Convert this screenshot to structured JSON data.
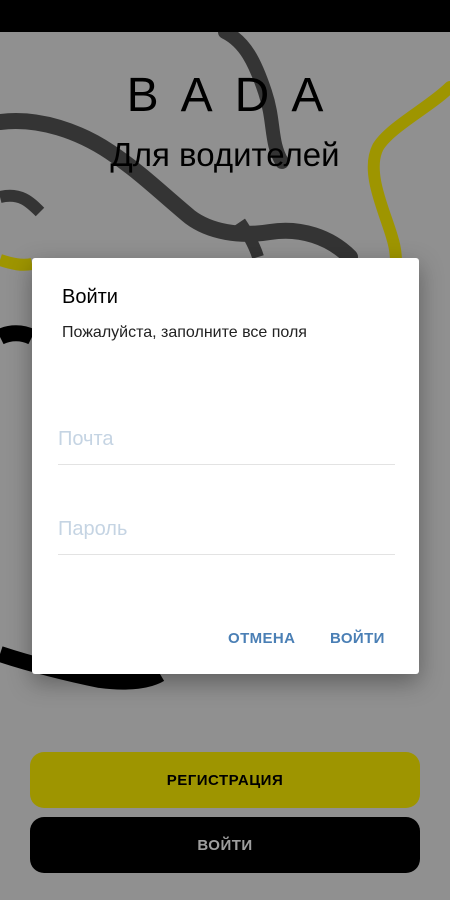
{
  "brand": {
    "title": "BADA",
    "subtitle": "Для водителей"
  },
  "buttons": {
    "register_label": "РЕГИСТРАЦИЯ",
    "login_label": "ВОЙТИ"
  },
  "dialog": {
    "title": "Войти",
    "message": "Пожалуйста, заполните все поля",
    "email_placeholder": "Почта",
    "password_placeholder": "Пароль",
    "cancel_label": "ОТМЕНА",
    "confirm_label": "ВОЙТИ"
  },
  "colors": {
    "accent_yellow": "#fff000",
    "road_gray": "#555555",
    "road_black": "#000000",
    "link_blue": "#4a7fb5"
  }
}
